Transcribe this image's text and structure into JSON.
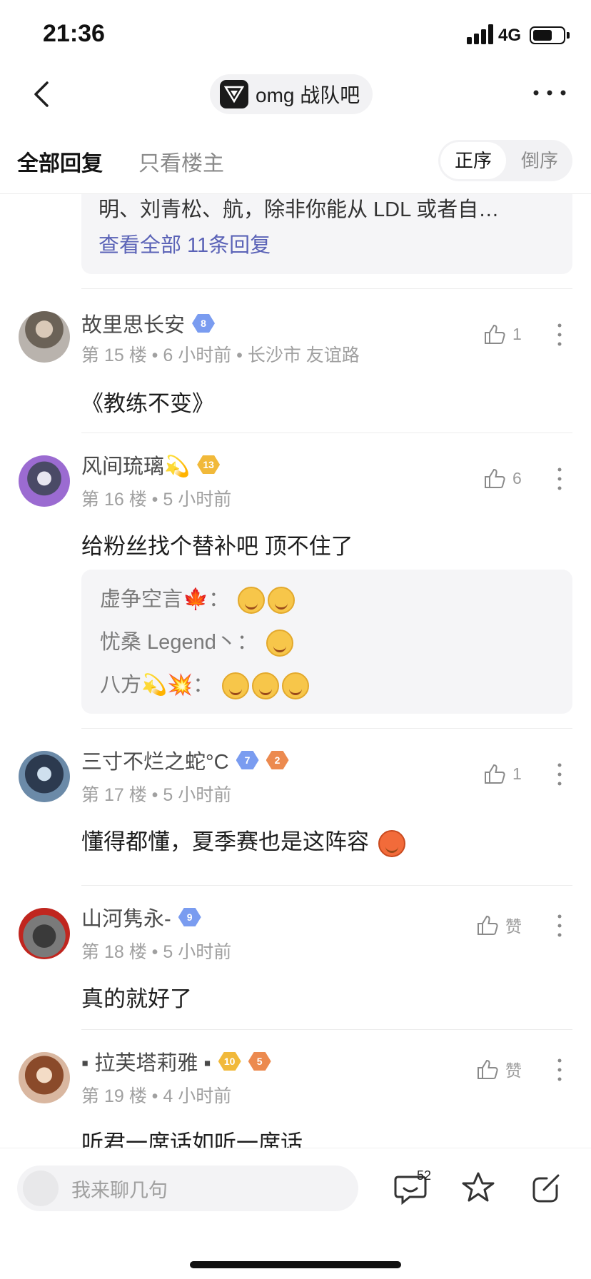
{
  "status": {
    "time": "21:36",
    "network": "4G"
  },
  "nav": {
    "forum_name": "omg 战队吧"
  },
  "tabs": {
    "all_label": "全部回复",
    "op_only_label": "只看楼主",
    "sort_asc": "正序",
    "sort_desc": "倒序"
  },
  "top_reply": {
    "preview": "明、刘青松、航，除非你能从 LDL 或者自…",
    "view_all": "查看全部 11条回复"
  },
  "posts": [
    {
      "user": "故里思长安",
      "level": "8",
      "level_color": "#7a9cf0",
      "floor_meta": "第 15 楼 • 6 小时前 • 长沙市 友谊路",
      "content": "《教练不变》",
      "likes": "1"
    },
    {
      "user": "风间琉璃💫",
      "level": "13",
      "level_color": "#f1b93a",
      "floor_meta": "第 16 楼 • 5 小时前",
      "content": "给粉丝找个替补吧 顶不住了",
      "likes": "6",
      "replies": [
        {
          "name": "虚争空言🍁："
        },
        {
          "name": "忧桑 Legend丶："
        },
        {
          "name": "八方💫💥："
        }
      ]
    },
    {
      "user": "三寸不烂之蛇°C",
      "level": "7",
      "level_color": "#7a9cf0",
      "extra_badge": "2",
      "floor_meta": "第 17 楼 • 5 小时前",
      "content": "懂得都懂，夏季赛也是这阵容",
      "likes": "1"
    },
    {
      "user": "山河隽永-",
      "level": "9",
      "level_color": "#7a9cf0",
      "floor_meta": "第 18 楼 • 5 小时前",
      "content": "真的就好了",
      "likes": "赞"
    },
    {
      "user": "▪ 拉芙塔莉雅 ▪",
      "level": "10",
      "level_color": "#f1b93a",
      "extra_badge": "5",
      "floor_meta": "第 19 楼 • 4 小时前",
      "content": "听君一席话如听一席话",
      "likes": "赞"
    }
  ],
  "bottom": {
    "placeholder": "我来聊几句",
    "comment_count": "52"
  }
}
